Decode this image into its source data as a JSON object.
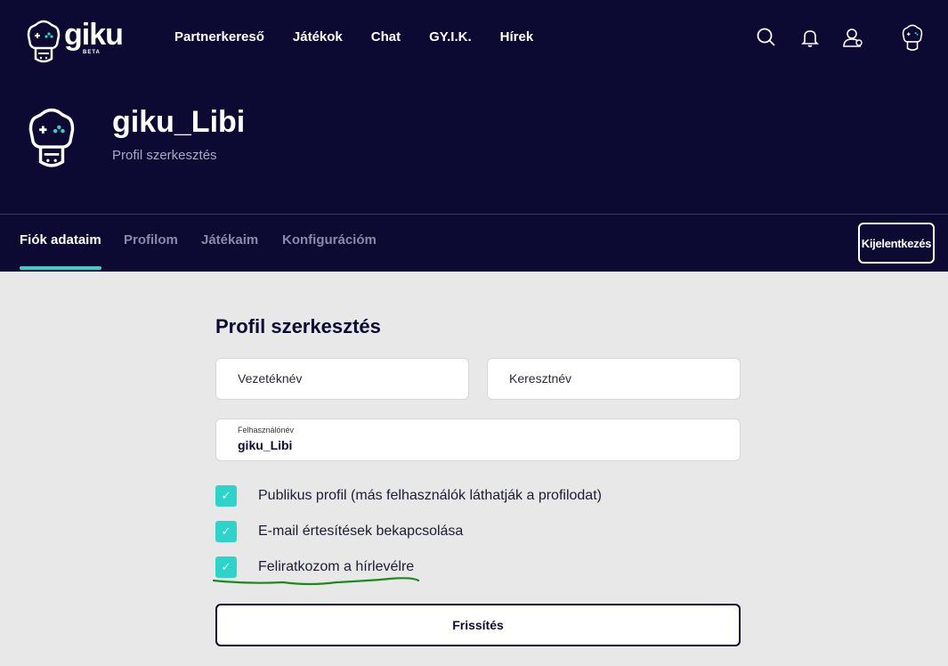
{
  "brand": {
    "name": "giku",
    "badge": "BETA"
  },
  "nav": {
    "items": [
      "Partnerkereső",
      "Játékok",
      "Chat",
      "GY.I.K.",
      "Hírek"
    ]
  },
  "header_icons": [
    "search-icon",
    "bell-icon",
    "user-icon",
    "avatar-icon"
  ],
  "hero": {
    "username": "giku_Libi",
    "subtitle": "Profil szerkesztés"
  },
  "tabs": [
    "Fiók adataim",
    "Profilom",
    "Játékaim",
    "Konfigurációm"
  ],
  "active_tab": "Fiók adataim",
  "logout_label": "Kijelentkezés",
  "form": {
    "title": "Profil szerkesztés",
    "last_name_placeholder": "Vezetéknév",
    "first_name_placeholder": "Keresztnév",
    "username_label": "Felhasználónév",
    "username_value": "giku_Libi",
    "checkboxes": [
      {
        "label": "Publikus profil (más felhasználók láthatják a profilodat)",
        "checked": true
      },
      {
        "label": "E-mail értesítések bekapcsolása",
        "checked": true
      },
      {
        "label": "Feliratkozom a hírlevélre",
        "checked": true
      }
    ],
    "submit_label": "Frissítés"
  },
  "colors": {
    "navy": "#0c0a33",
    "accent": "#2ed4c9",
    "annotation": "#1a8a1a",
    "bg": "#e8e8e8"
  }
}
